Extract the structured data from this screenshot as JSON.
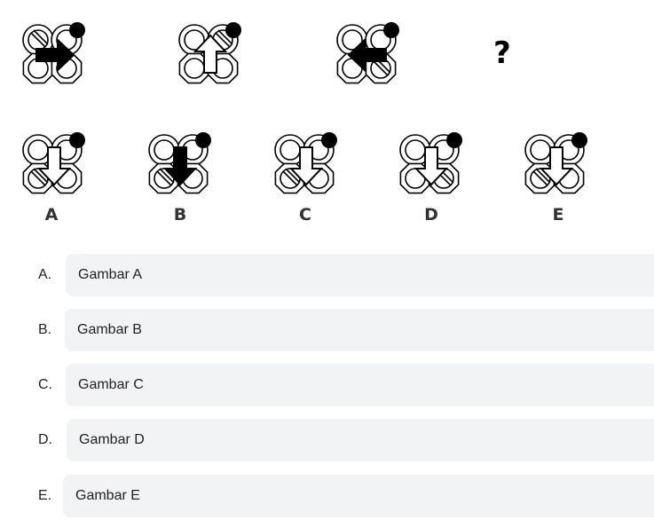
{
  "question": {
    "figures": [
      {
        "arrow": "right",
        "filled": true,
        "slashed_quadrant": "top-left"
      },
      {
        "arrow": "up",
        "filled": false,
        "slashed_quadrant": "top-right"
      },
      {
        "arrow": "left",
        "filled": true,
        "slashed_quadrant": "bottom-right"
      }
    ],
    "missing": "?"
  },
  "options": [
    {
      "label": "A",
      "arrow": "down",
      "filled": false,
      "slashed_quadrant": "bottom-left"
    },
    {
      "label": "B",
      "arrow": "down",
      "filled": true,
      "slashed_quadrant": "bottom-left"
    },
    {
      "label": "C",
      "arrow": "down",
      "filled": false,
      "slashed_quadrant": "bottom-left"
    },
    {
      "label": "D",
      "arrow": "down",
      "filled": false,
      "slashed_quadrant": "bottom-right"
    },
    {
      "label": "E",
      "arrow": "down",
      "filled": false,
      "slashed_quadrant": "bottom-left"
    }
  ],
  "answers": [
    {
      "letter": "A.",
      "text": "Gambar A"
    },
    {
      "letter": "B.",
      "text": "Gambar B"
    },
    {
      "letter": "C.",
      "text": "Gambar C"
    },
    {
      "letter": "D.",
      "text": "Gambar D"
    },
    {
      "letter": "E.",
      "text": "Gambar E"
    }
  ]
}
